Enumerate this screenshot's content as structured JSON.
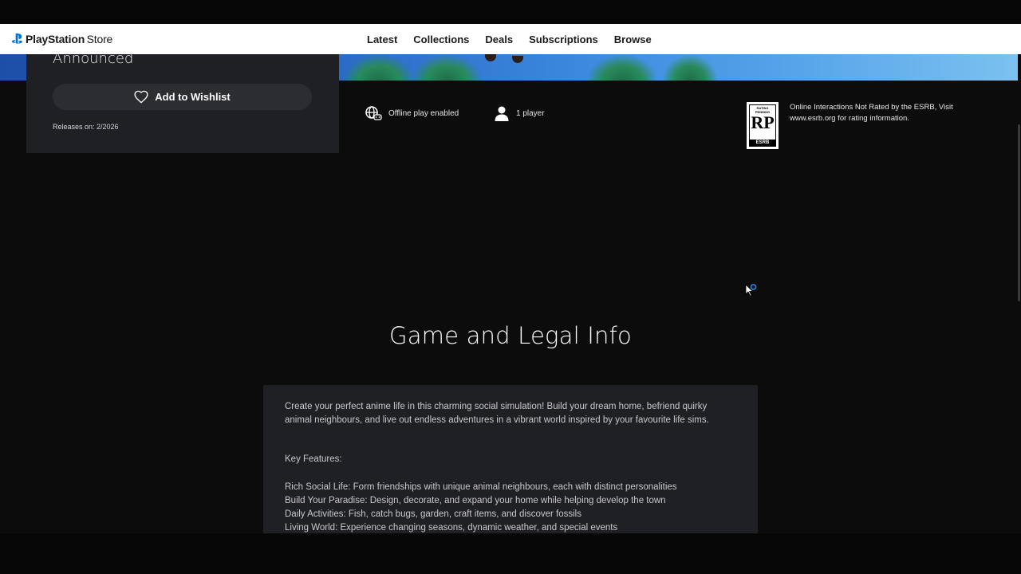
{
  "header": {
    "brand_bold": "PlayStation",
    "brand_rest": "Store",
    "nav": [
      "Latest",
      "Collections",
      "Deals",
      "Subscriptions",
      "Browse"
    ]
  },
  "product": {
    "status": "Announced",
    "wishlist_label": "Add to Wishlist",
    "release_text": "Releases on: 2/2026"
  },
  "features": [
    {
      "icon": "offline-globe-icon",
      "label": "Offline play enabled"
    },
    {
      "icon": "person-icon",
      "label": "1 player"
    }
  ],
  "esrb": {
    "badge_top": "RATING PENDING",
    "badge_code": "RP",
    "badge_bottom": "ESRB",
    "notice": "Online Interactions Not Rated by the ESRB, Visit www.esrb.org for rating information."
  },
  "info": {
    "title": "Game and Legal Info",
    "description": "Create your perfect anime life in this charming social simulation! Build your dream home, befriend quirky animal neighbours, and live out endless adventures in a vibrant world inspired by your favourite life sims.",
    "key_features_title": "Key Features:",
    "key_features": [
      "Rich Social Life: Form friendships with unique animal neighbours, each with distinct personalities",
      "Build Your Paradise: Design, decorate, and expand your home while helping develop the town",
      "Daily Activities: Fish, catch bugs, garden, craft items, and discover fossils",
      "Living World: Experience changing seasons, dynamic weather, and special events"
    ]
  },
  "colors": {
    "background": "#0c0c0c",
    "panel": "#1f2024",
    "header": "#ffffff",
    "ps_blue": "#0070d1"
  }
}
